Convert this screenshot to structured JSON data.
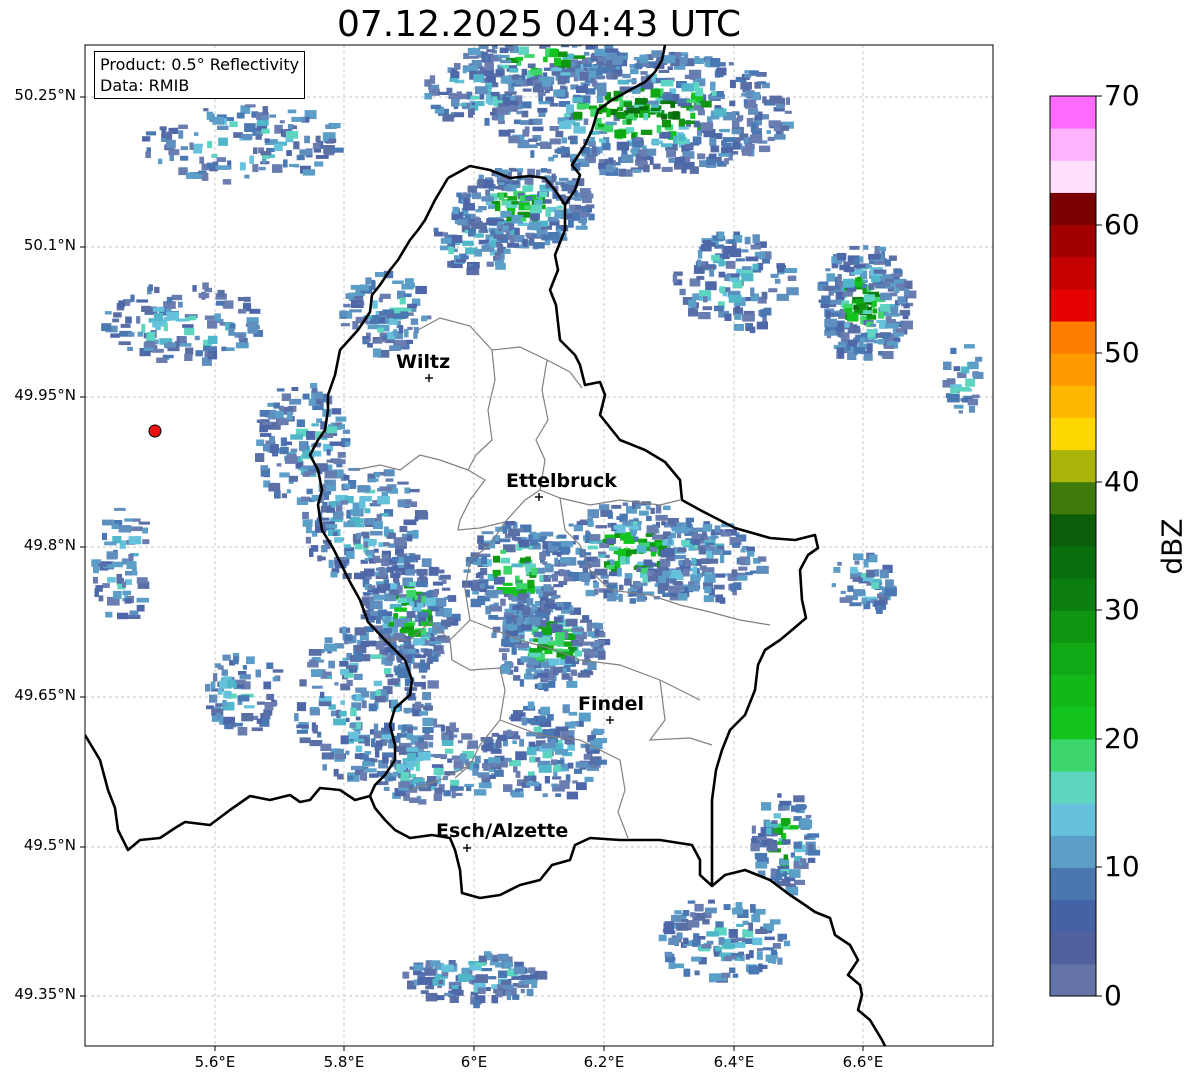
{
  "title": "07.12.2025 04:43 UTC",
  "info": {
    "product": "Product: 0.5° Reflectivity",
    "data": "Data: RMIB"
  },
  "axes": {
    "lon_range": [
      5.4,
      6.8
    ],
    "lat_range": [
      49.28,
      50.29
    ],
    "x_ticks": [
      "5.6°E",
      "5.8°E",
      "6°E",
      "6.2°E",
      "6.4°E",
      "6.6°E"
    ],
    "y_ticks": [
      "50.25°N",
      "50.1°N",
      "49.95°N",
      "49.8°N",
      "49.65°N",
      "49.5°N",
      "49.35°N"
    ],
    "grid": true
  },
  "colorbar": {
    "label": "dBZ",
    "ticks": [
      "70",
      "60",
      "50",
      "40",
      "30",
      "20",
      "10",
      "0"
    ],
    "min": 0,
    "max": 70,
    "colors": [
      "#6474a8",
      "#50619e",
      "#4562a6",
      "#4a77b0",
      "#5b9ec8",
      "#66c1dc",
      "#5dd5c0",
      "#3cd66c",
      "#14c41e",
      "#12b818",
      "#10a814",
      "#0f9512",
      "#0c7e10",
      "#0a6e0c",
      "#0b5d0a",
      "#3e7a0c",
      "#aab40a",
      "#ffd700",
      "#ffb800",
      "#ff9a00",
      "#ff7e00",
      "#e60000",
      "#c40000",
      "#a20000",
      "#7a0000",
      "#ffe0ff",
      "#ffb3ff",
      "#ff6bff",
      "#e83ce8"
    ]
  },
  "places": [
    {
      "name": "Wiltz"
    },
    {
      "name": "Ettelbruck"
    },
    {
      "name": "Findel"
    },
    {
      "name": "Esch/Alzette"
    }
  ],
  "radar_site_color": "#ee1111"
}
